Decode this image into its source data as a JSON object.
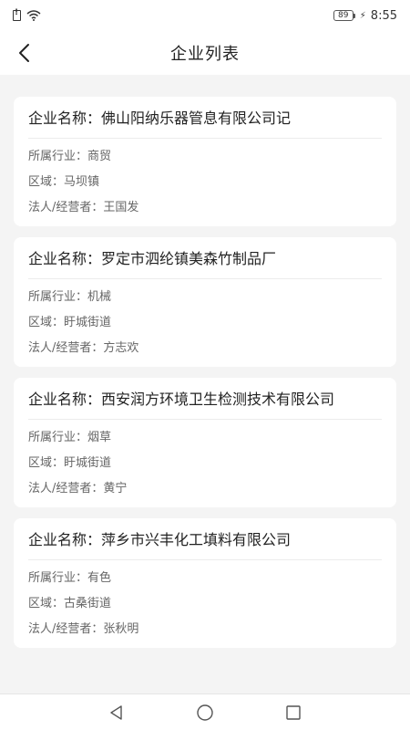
{
  "status_bar": {
    "battery_level": "89",
    "time": "8:55"
  },
  "header": {
    "title": "企业列表"
  },
  "companies": [
    {
      "name_label": "企业名称：",
      "name": "佛山阳纳乐器管息有限公司记",
      "industry_label": "所属行业：",
      "industry": "商贸",
      "region_label": "区域：",
      "region": "马坝镇",
      "legal_label": "法人/经营者：",
      "legal": "王国发"
    },
    {
      "name_label": "企业名称：",
      "name": "罗定市泗纶镇美森竹制品厂",
      "industry_label": "所属行业：",
      "industry": "机械",
      "region_label": "区域：",
      "region": "盱城街道",
      "legal_label": "法人/经营者：",
      "legal": "方志欢"
    },
    {
      "name_label": "企业名称：",
      "name": "西安润方环境卫生检测技术有限公司",
      "industry_label": "所属行业：",
      "industry": "烟草",
      "region_label": "区域：",
      "region": "盱城街道",
      "legal_label": "法人/经营者：",
      "legal": "黄宁"
    },
    {
      "name_label": "企业名称：",
      "name": "萍乡市兴丰化工填料有限公司",
      "industry_label": "所属行业：",
      "industry": "有色",
      "region_label": "区域：",
      "region": "古桑街道",
      "legal_label": "法人/经营者：",
      "legal": "张秋明"
    }
  ],
  "icons": {
    "back": "back-arrow-icon",
    "nav_back": "triangle-back-icon",
    "nav_home": "circle-home-icon",
    "nav_recent": "square-recent-icon"
  }
}
